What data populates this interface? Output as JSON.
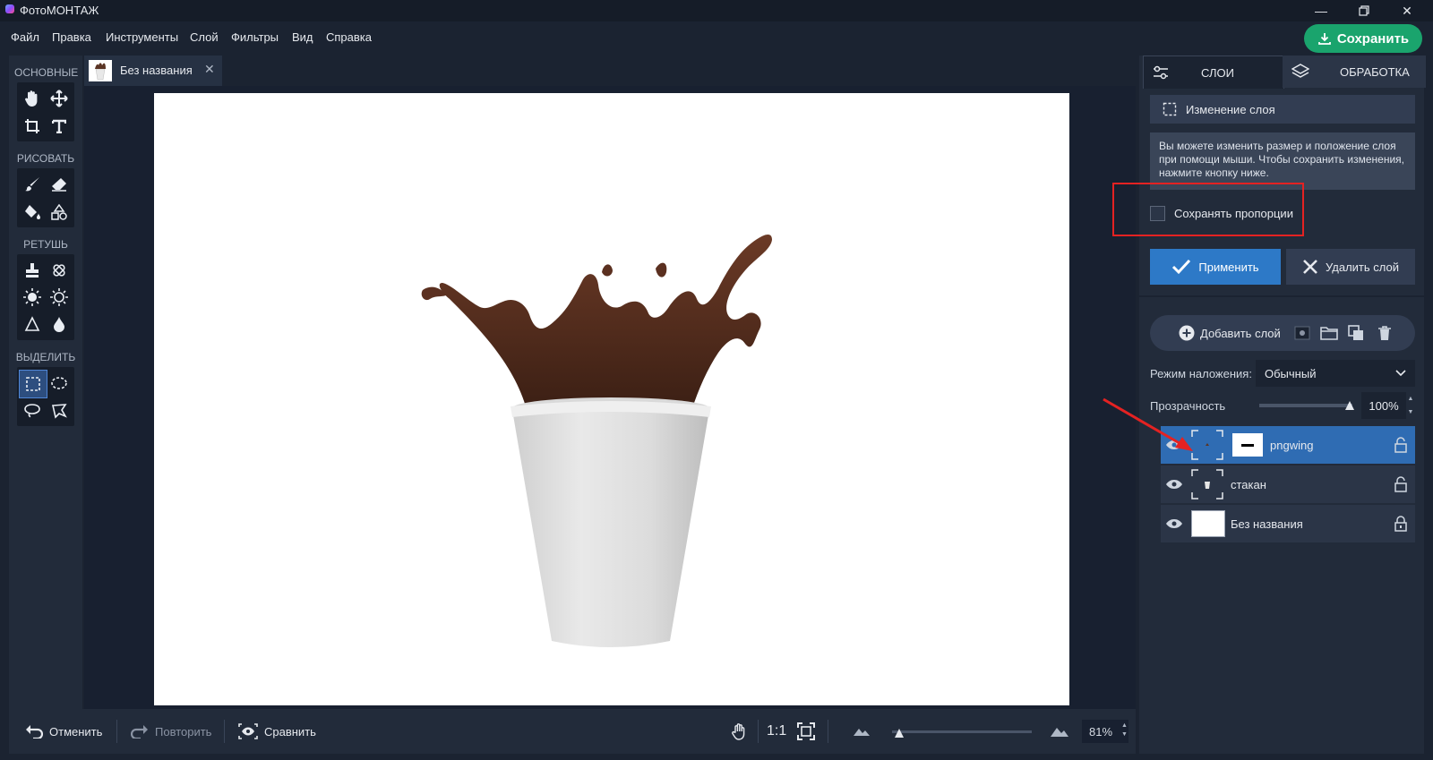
{
  "app": {
    "title": "ФотоМОНТАЖ",
    "window_controls": [
      "minimize-icon",
      "restore-icon",
      "close-icon"
    ]
  },
  "menu": {
    "items": [
      "Файл",
      "Правка",
      "Инструменты",
      "Слой",
      "Фильтры",
      "Вид",
      "Справка"
    ],
    "save_button": "Сохранить"
  },
  "colors": {
    "accent_blue": "#2d79c7",
    "save_green": "#1aa46d",
    "annotation_red": "#e42222",
    "selected_layer": "#2f6cb3"
  },
  "tools": {
    "sections": [
      {
        "label": "ОСНОВНЫЕ",
        "tools": [
          "hand-icon",
          "move-icon",
          "crop-icon",
          "text-icon"
        ]
      },
      {
        "label": "РИСОВАТЬ",
        "tools": [
          "brush-icon",
          "eraser-icon",
          "fill-icon",
          "shapes-icon"
        ]
      },
      {
        "label": "РЕТУШЬ",
        "tools": [
          "stamp-icon",
          "patch-icon",
          "brighten-icon",
          "darken-icon",
          "sharpen-icon",
          "blur-drop-icon"
        ]
      },
      {
        "label": "ВЫДЕЛИТЬ",
        "tools": [
          "rect-select-icon",
          "ellipse-select-icon",
          "lasso-icon",
          "polygon-lasso-icon"
        ]
      }
    ],
    "active_tool": "rect-select-icon"
  },
  "document": {
    "tab_name": "Без названия"
  },
  "bottom": {
    "undo": "Отменить",
    "redo": "Повторить",
    "compare": "Сравнить",
    "actual_size": "1:1",
    "zoom": "81%",
    "zoom_level": 0.05
  },
  "right_panel": {
    "tabs": [
      "СЛОИ",
      "ОБРАБОТКА"
    ],
    "active_tab": "СЛОИ",
    "change_layer": "Изменение слоя",
    "hint": "Вы можете изменить размер и положение слоя при помощи мыши. Чтобы сохранить изменения, нажмите кнопку ниже.",
    "keep_proportions": "Сохранять пропорции",
    "keep_proportions_checked": false,
    "apply": "Применить",
    "delete_layer": "Удалить слой",
    "add_layer": "Добавить слой",
    "blend_label": "Режим наложения:",
    "blend_value": "Обычный",
    "opacity_label": "Прозрачность",
    "opacity_value": "100%",
    "layers": [
      {
        "name": "pngwing",
        "selected": true,
        "locked": false
      },
      {
        "name": "стакан",
        "selected": false,
        "locked": false
      },
      {
        "name": "Без названия",
        "selected": false,
        "locked": true
      }
    ]
  }
}
